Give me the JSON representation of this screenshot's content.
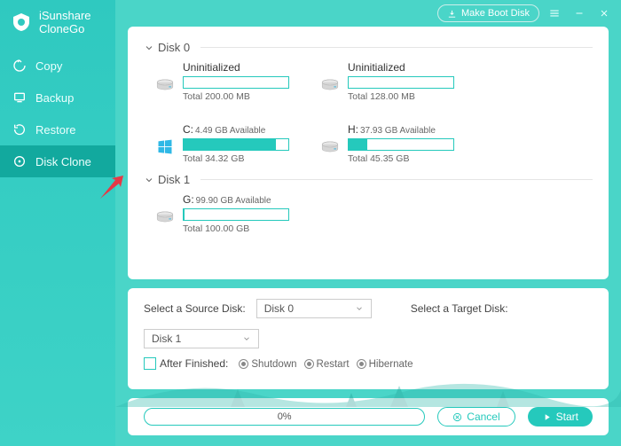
{
  "brand": {
    "line1": "iSunshare",
    "line2": "CloneGo"
  },
  "titlebar": {
    "make_boot": "Make Boot Disk"
  },
  "sidebar": {
    "items": [
      {
        "label": "Copy"
      },
      {
        "label": "Backup"
      },
      {
        "label": "Restore"
      },
      {
        "label": "Disk Clone"
      }
    ]
  },
  "disks": [
    {
      "name": "Disk 0",
      "partitions": [
        {
          "kind": "drive",
          "title": "Uninitialized",
          "avail": "",
          "fill_pct": 0,
          "total": "Total 200.00 MB"
        },
        {
          "kind": "drive",
          "title": "Uninitialized",
          "avail": "",
          "fill_pct": 0,
          "total": "Total 128.00 MB"
        },
        {
          "kind": "os",
          "title": "C:",
          "avail": "4.49 GB Available",
          "fill_pct": 88,
          "total": "Total 34.32 GB"
        },
        {
          "kind": "drive",
          "title": "H:",
          "avail": "37.93 GB Available",
          "fill_pct": 18,
          "total": "Total 45.35 GB"
        }
      ]
    },
    {
      "name": "Disk 1",
      "partitions": [
        {
          "kind": "drive",
          "title": "G:",
          "avail": "99.90 GB Available",
          "fill_pct": 1,
          "total": "Total 100.00 GB"
        }
      ]
    }
  ],
  "opts": {
    "source_label": "Select a Source Disk:",
    "source_value": "Disk 0",
    "target_label": "Select a Target Disk:",
    "target_value": "Disk 1",
    "after_label": "After Finished:",
    "radios": [
      "Shutdown",
      "Restart",
      "Hibernate"
    ]
  },
  "actions": {
    "progress_text": "0%",
    "cancel": "Cancel",
    "start": "Start"
  }
}
